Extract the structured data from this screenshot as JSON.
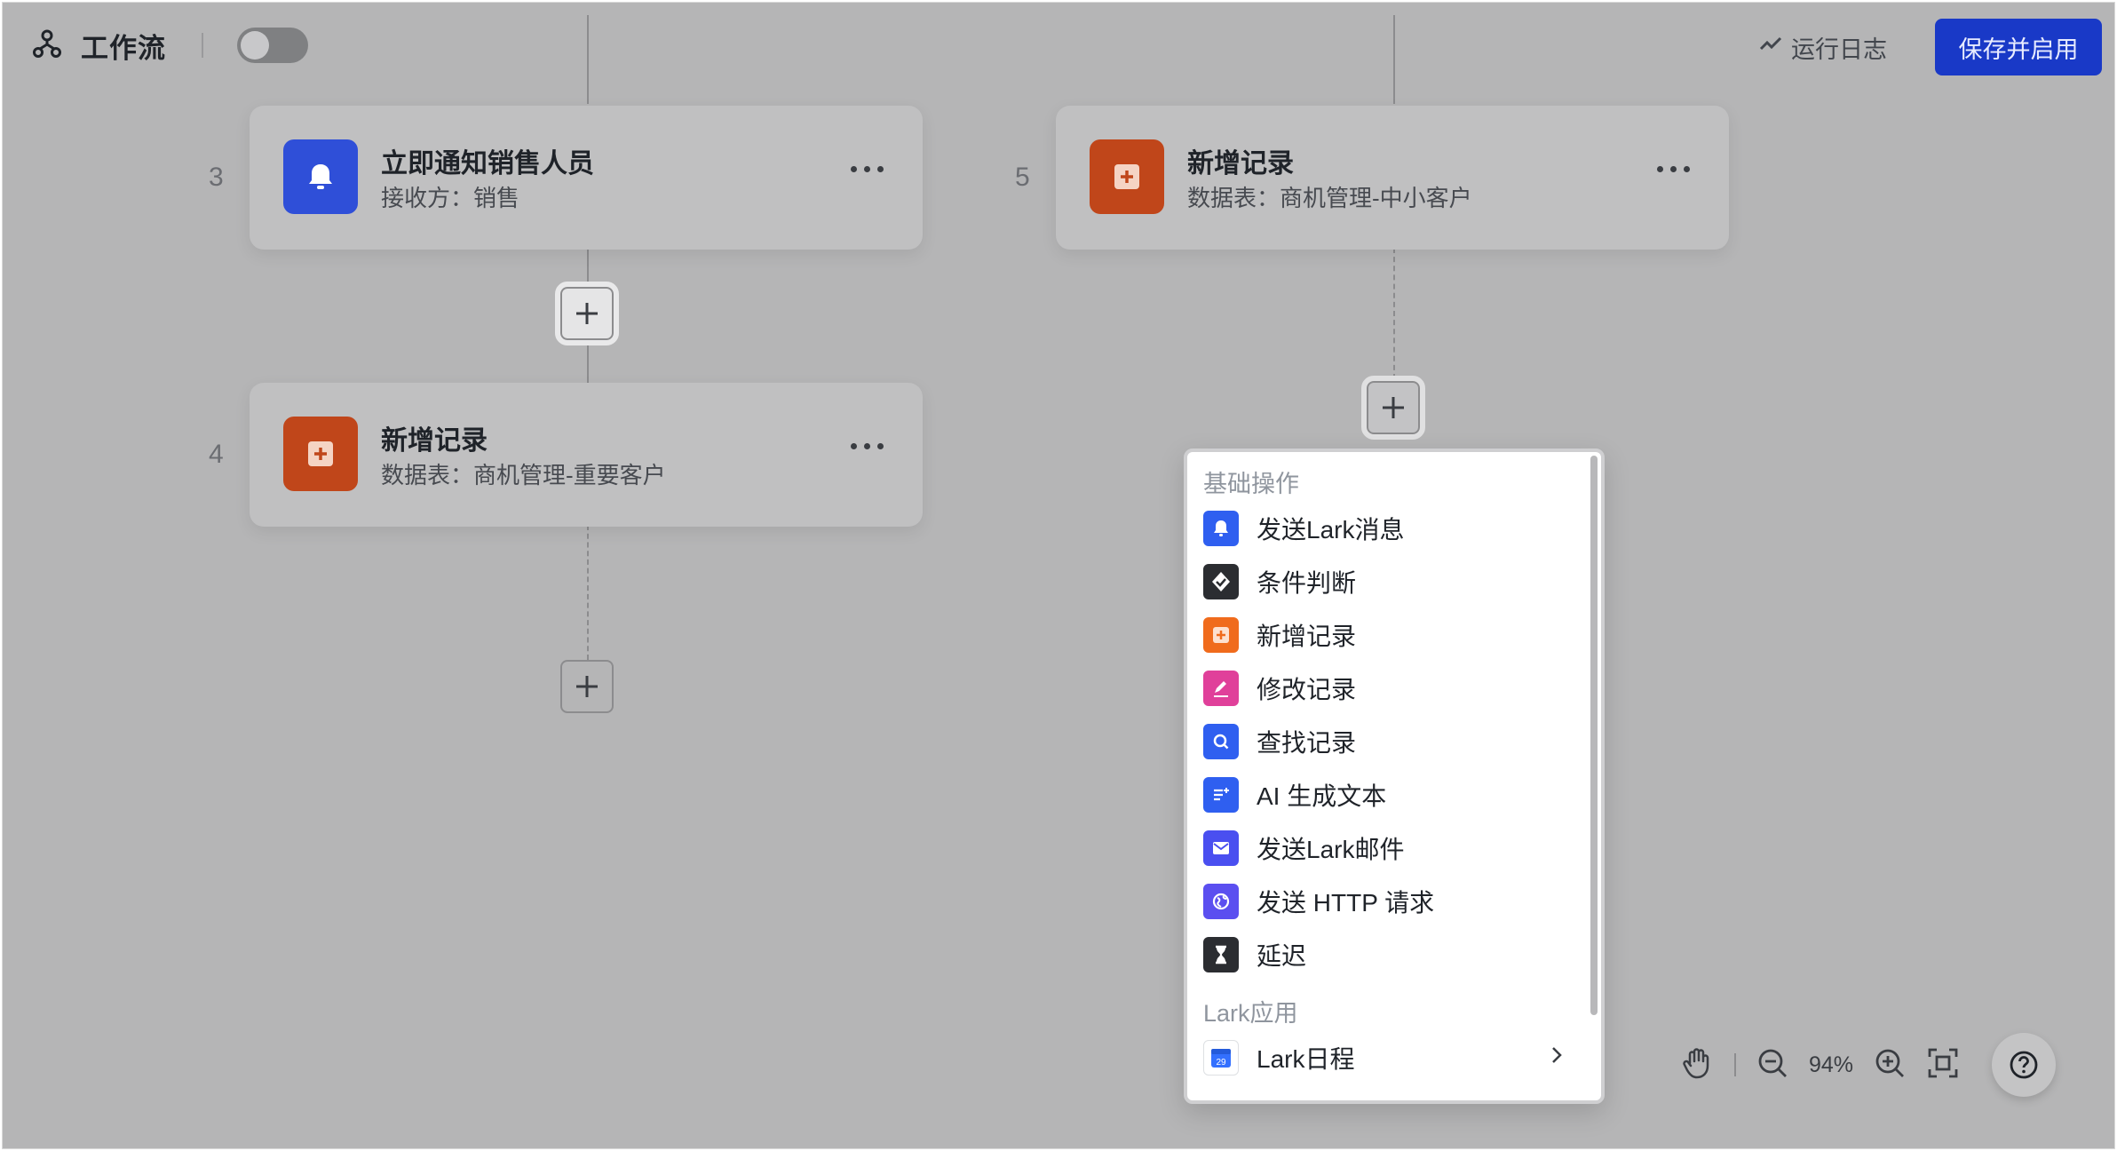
{
  "header": {
    "title": "工作流",
    "run_log": "运行日志",
    "save_enable": "保存并启用",
    "toggle_on": false
  },
  "nodes": [
    {
      "number": "3",
      "title": "立即通知销售人员",
      "subtitle": "接收方：销售",
      "icon": "bell-icon",
      "color": "#2f4fd8"
    },
    {
      "number": "4",
      "title": "新增记录",
      "subtitle": "数据表：商机管理-重要客户",
      "icon": "add-record-icon",
      "color": "#c0461a"
    },
    {
      "number": "5",
      "title": "新增记录",
      "subtitle": "数据表：商机管理-中小客户",
      "icon": "add-record-icon",
      "color": "#c0461a"
    }
  ],
  "menu": {
    "section_basic": "基础操作",
    "items": [
      {
        "label": "发送Lark消息",
        "icon": "bell-icon",
        "color": "#2f5ff0"
      },
      {
        "label": "条件判断",
        "icon": "branch-check-icon",
        "color": "#2b2d31"
      },
      {
        "label": "新增记录",
        "icon": "add-record-icon",
        "color": "#f06b1c"
      },
      {
        "label": "修改记录",
        "icon": "edit-icon",
        "color": "#e0409a"
      },
      {
        "label": "查找记录",
        "icon": "search-icon",
        "color": "#2f5ff0"
      },
      {
        "label": "AI 生成文本",
        "icon": "ai-text-icon",
        "color": "#2f5ff0"
      },
      {
        "label": "发送Lark邮件",
        "icon": "mail-icon",
        "color": "#4a4ff0"
      },
      {
        "label": "发送 HTTP 请求",
        "icon": "globe-icon",
        "color": "#5b4ff0"
      },
      {
        "label": "延迟",
        "icon": "hourglass-icon",
        "color": "#2b2d31"
      }
    ],
    "section_apps": "Lark应用",
    "app_items": [
      {
        "label": "Lark日程",
        "icon": "calendar-icon",
        "badge": "29"
      }
    ]
  },
  "zoom": {
    "level": "94%"
  }
}
